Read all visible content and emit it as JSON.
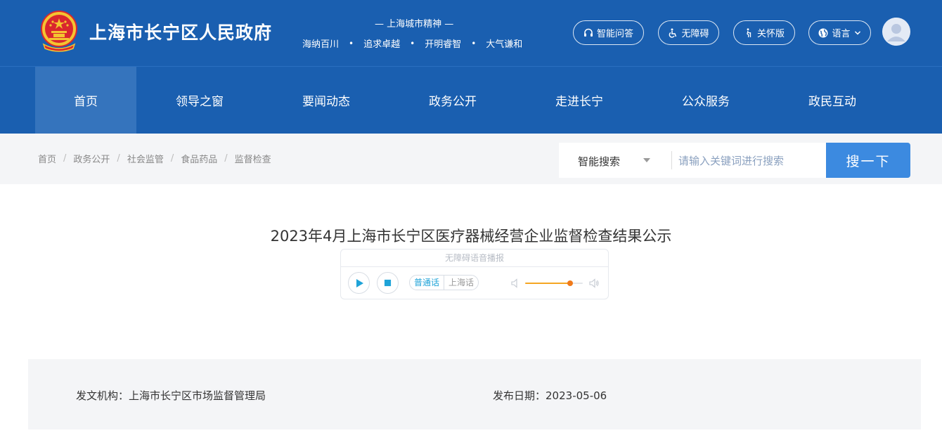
{
  "header": {
    "site_title": "上海市长宁区人民政府",
    "spirit_heading": "— 上海城市精神 —",
    "spirit_phrases": [
      "海纳百川",
      "追求卓越",
      "开明睿智",
      "大气谦和"
    ],
    "spirit_separator": "•",
    "buttons": {
      "qa": "智能问答",
      "accessible": "无障碍",
      "care": "关怀版",
      "language": "语言"
    }
  },
  "nav": {
    "items": [
      "首页",
      "领导之窗",
      "要闻动态",
      "政务公开",
      "走进长宁",
      "公众服务",
      "政民互动"
    ],
    "active_index": 0
  },
  "breadcrumb": {
    "items": [
      "首页",
      "政务公开",
      "社会监管",
      "食品药品",
      "监督检查"
    ],
    "separator": "/"
  },
  "search": {
    "type_label": "智能搜索",
    "placeholder": "请输入关键词进行搜索",
    "value": "",
    "button_label": "搜一下"
  },
  "article": {
    "title": "2023年4月上海市长宁区医疗器械经营企业监督检查结果公示",
    "player": {
      "header": "无障碍语音播报",
      "lang_options": [
        "普通话",
        "上海话"
      ],
      "active_lang_index": 0,
      "volume": 0.78
    },
    "meta": {
      "issuer_label": "发文机构：",
      "issuer": "上海市长宁区市场监督管理局",
      "date_label": "发布日期：",
      "date": "2023-05-06"
    }
  },
  "colors": {
    "header_bg": "#1a5fb0",
    "nav_active_bg": "#3574bd",
    "search_button_bg": "#3c8ae0",
    "player_accent": "#1fa3d8",
    "volume_accent": "#f07a1a"
  }
}
